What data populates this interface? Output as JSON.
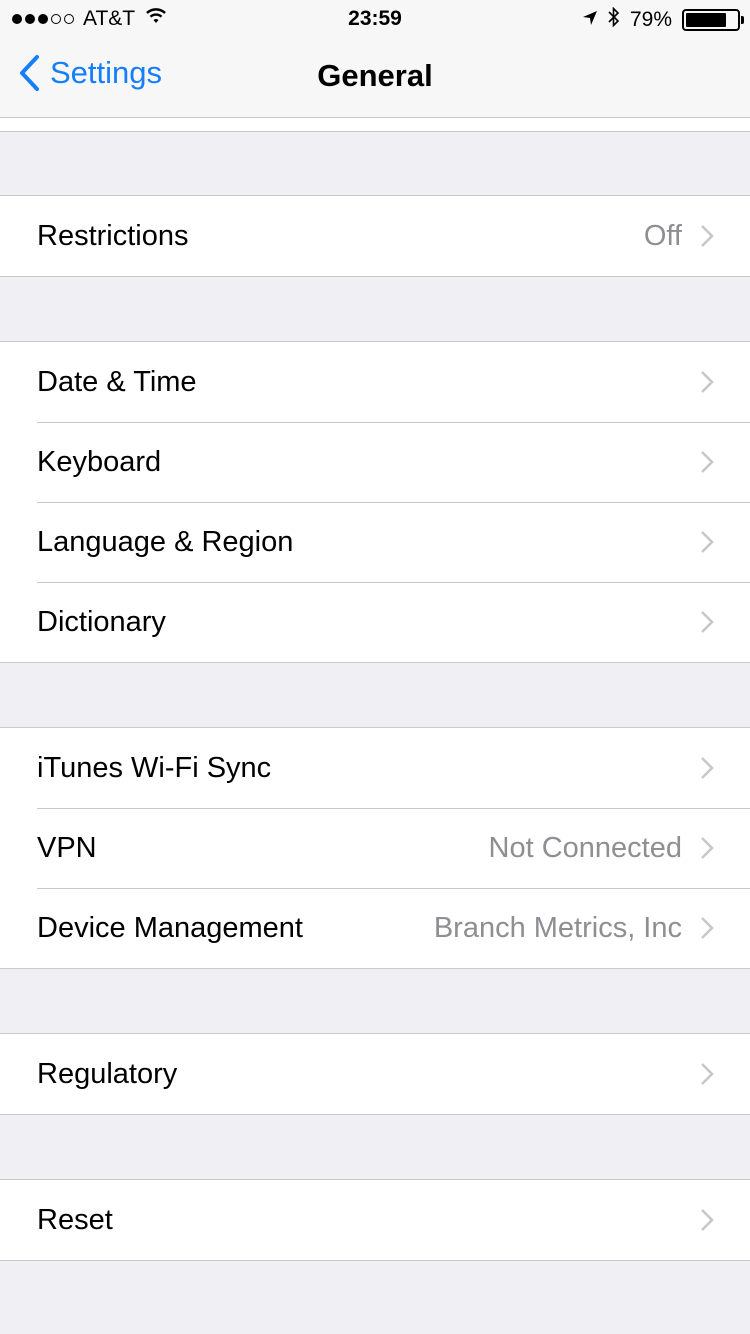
{
  "status_bar": {
    "carrier": "AT&T",
    "time": "23:59",
    "battery_percent_text": "79%",
    "battery_level": 0.79,
    "signal_dots_filled": 3,
    "signal_dots_total": 5
  },
  "nav": {
    "back_label": "Settings",
    "title": "General"
  },
  "groups": [
    {
      "rows": [
        {
          "label": "Restrictions",
          "value": "Off"
        }
      ]
    },
    {
      "rows": [
        {
          "label": "Date & Time",
          "value": ""
        },
        {
          "label": "Keyboard",
          "value": ""
        },
        {
          "label": "Language & Region",
          "value": ""
        },
        {
          "label": "Dictionary",
          "value": ""
        }
      ]
    },
    {
      "rows": [
        {
          "label": "iTunes Wi-Fi Sync",
          "value": ""
        },
        {
          "label": "VPN",
          "value": "Not Connected"
        },
        {
          "label": "Device Management",
          "value": "Branch Metrics, Inc"
        }
      ]
    },
    {
      "rows": [
        {
          "label": "Regulatory",
          "value": ""
        }
      ]
    },
    {
      "rows": [
        {
          "label": "Reset",
          "value": ""
        }
      ]
    }
  ],
  "colors": {
    "accent": "#147efb",
    "background": "#efeff4",
    "separator": "#c8c7cc",
    "secondary_text": "#8e8e93",
    "chevron": "#c7c7cc"
  },
  "icons": {
    "back": "chevron-left-icon",
    "disclosure": "chevron-right-icon",
    "wifi": "wifi-icon",
    "location": "location-arrow-icon",
    "bluetooth": "bluetooth-icon",
    "battery": "battery-icon"
  }
}
